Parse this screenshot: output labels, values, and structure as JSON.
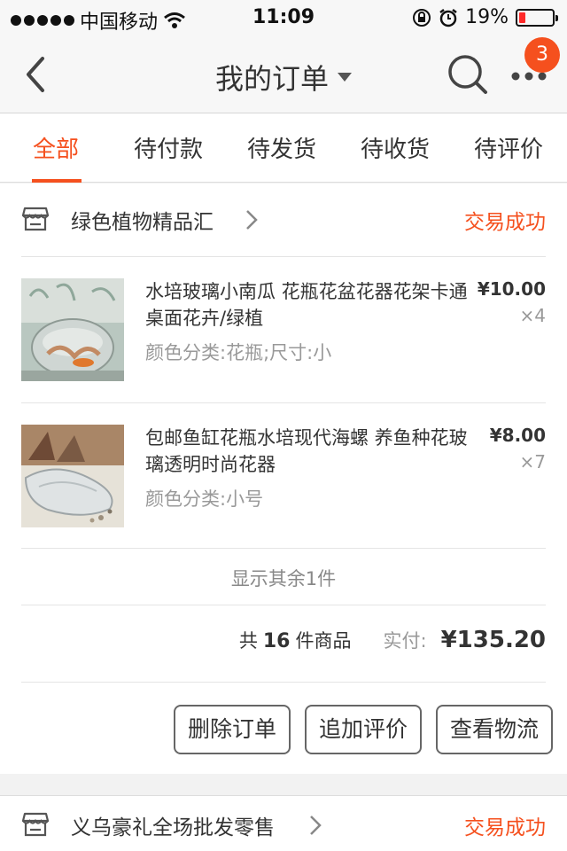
{
  "status_bar": {
    "carrier": "中国移动",
    "time": "11:09",
    "battery": "19%",
    "battery_level": 0.19
  },
  "nav": {
    "title": "我的订单",
    "badge_count": "3",
    "back_icon": "chevron-left-icon",
    "search_icon": "search-icon",
    "more_icon": "more-icon"
  },
  "tabs": [
    "全部",
    "待付款",
    "待发货",
    "待收货",
    "待评价"
  ],
  "orders": [
    {
      "shop": "绿色植物精品汇",
      "status": "交易成功",
      "items": [
        {
          "title": "水培玻璃小南瓜 花瓶花盆花器花架卡通桌面花卉/绿植",
          "spec": "颜色分类:花瓶;尺寸:小",
          "price": "¥10.00",
          "qty": "×4"
        },
        {
          "title": "包邮鱼缸花瓶水培现代海螺 养鱼种花玻璃透明时尚花器",
          "spec": "颜色分类:小号",
          "price": "¥8.00",
          "qty": "×7"
        }
      ],
      "show_more": "显示其余1件",
      "summary": {
        "prefix": "共",
        "count": "16",
        "suffix": "件商品",
        "pay_label": "实付:",
        "total": "¥135.20"
      },
      "actions": [
        "删除订单",
        "追加评价",
        "查看物流"
      ]
    },
    {
      "shop": "义乌豪礼全场批发零售",
      "status": "交易成功"
    }
  ],
  "colors": {
    "accent": "#f5501e",
    "text": "#333333",
    "muted": "#999999"
  }
}
